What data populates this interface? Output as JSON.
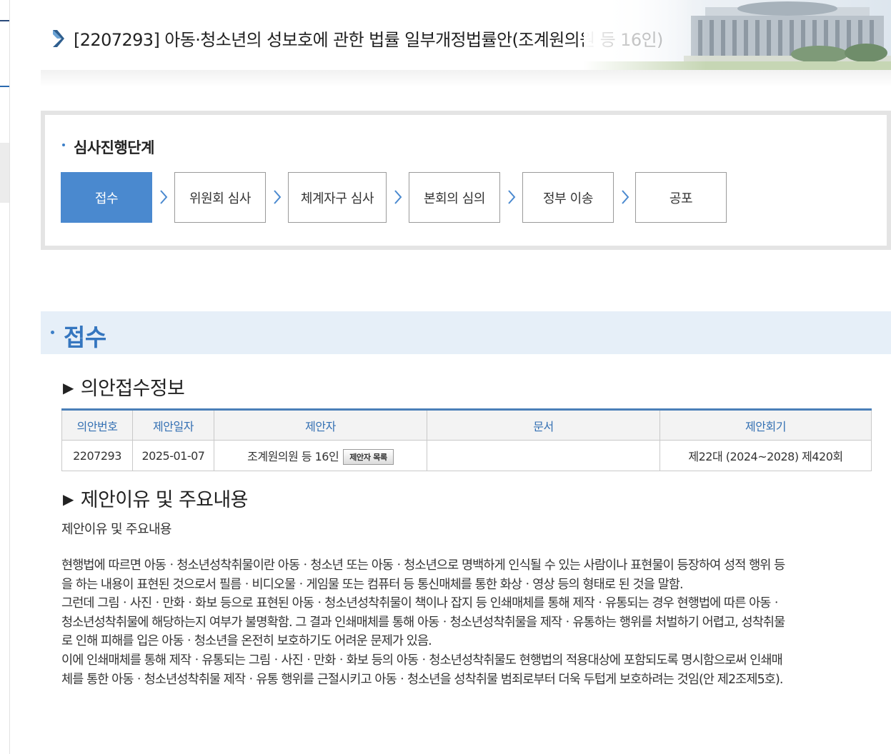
{
  "bill": {
    "title": "[2207293] 아동·청소년의 성보호에 관한 법률 일부개정법률안(조계원의원 등 16인)"
  },
  "progress": {
    "heading": "심사진행단계",
    "steps": [
      {
        "label": "접수",
        "active": true
      },
      {
        "label": "위원회 심사",
        "active": false
      },
      {
        "label": "체계자구 심사",
        "active": false
      },
      {
        "label": "본회의 심의",
        "active": false
      },
      {
        "label": "정부 이송",
        "active": false
      },
      {
        "label": "공포",
        "active": false
      }
    ]
  },
  "section": {
    "title": "접수"
  },
  "receipt_info": {
    "title": "의안접수정보",
    "headers": [
      "의안번호",
      "제안일자",
      "제안자",
      "문서",
      "제안회기"
    ],
    "row": {
      "bill_no": "2207293",
      "date": "2025-01-07",
      "proposer": "조계원의원 등 16인",
      "proposer_button": "제안자 목록",
      "document": "",
      "session": "제22대 (2024~2028) 제420회"
    }
  },
  "reason": {
    "title": "제안이유 및 주요내용",
    "label": "제안이유 및 주요내용",
    "lines": [
      "현행법에 따르면 아동ㆍ청소년성착취물이란 아동ㆍ청소년 또는 아동ㆍ청소년으로 명백하게 인식될 수 있는 사람이나 표현물이 등장하여 성적 행위 등",
      "을 하는 내용이 표현된 것으로서 필름ㆍ비디오물ㆍ게임물 또는 컴퓨터 등 통신매체를 통한 화상ㆍ영상 등의 형태로 된 것을 말함.",
      "그런데 그림ㆍ사진ㆍ만화ㆍ화보 등으로 표현된 아동ㆍ청소년성착취물이 책이나 잡지 등 인쇄매체를 통해 제작ㆍ유통되는 경우 현행법에 따른 아동ㆍ",
      "청소년성착취물에 해당하는지 여부가 불명확함. 그 결과 인쇄매체를 통해 아동ㆍ청소년성착취물을 제작ㆍ유통하는 행위를 처벌하기 어렵고, 성착취물",
      "로 인해 피해를 입은 아동ㆍ청소년을 온전히 보호하기도 어려운 문제가 있음.",
      "이에 인쇄매체를 통해 제작ㆍ유통되는 그림ㆍ사진ㆍ만화ㆍ화보 등의 아동ㆍ청소년성착취물도 현행법의 적용대상에 포함되도록 명시함으로써 인쇄매",
      "체를 통한 아동ㆍ청소년성착취물 제작ㆍ유통 행위를 근절시키고 아동ㆍ청소년을 성착취물 범죄로부터 더욱 두텁게 보호하려는 것임(안 제2조제5호)."
    ]
  },
  "colors": {
    "accent": "#4a89cf",
    "section_band": "#e6eff8",
    "header_text": "#3470b3"
  }
}
